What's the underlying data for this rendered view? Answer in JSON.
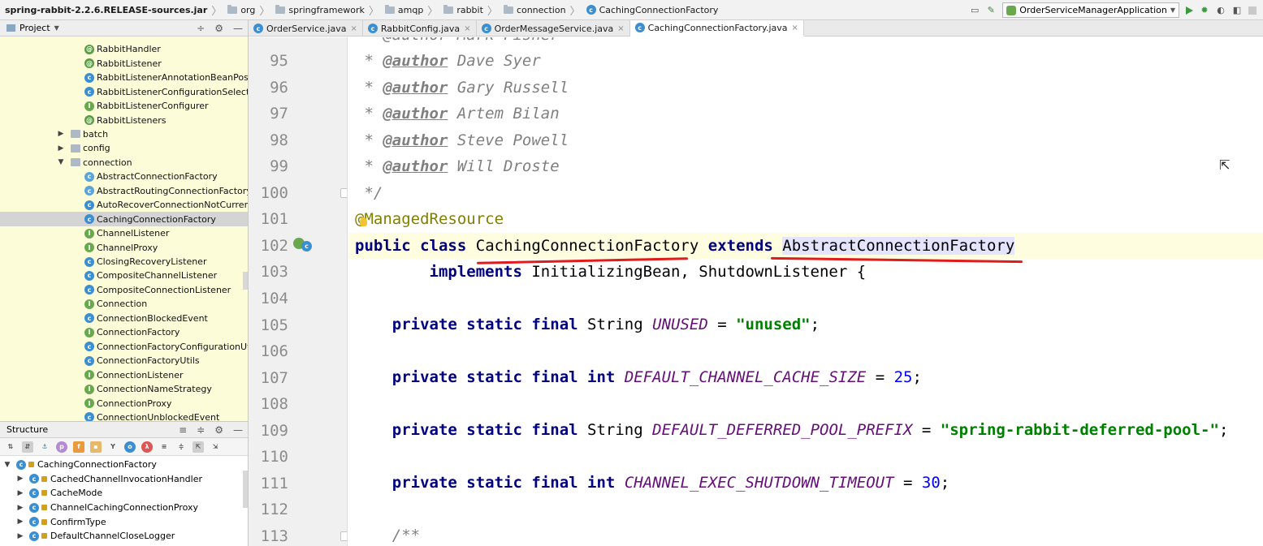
{
  "breadcrumbs": [
    {
      "label": "spring-rabbit-2.2.6.RELEASE-sources.jar",
      "icon": "jar"
    },
    {
      "label": "org",
      "icon": "folder-icon"
    },
    {
      "label": "springframework",
      "icon": "folder-icon"
    },
    {
      "label": "amqp",
      "icon": "folder-icon"
    },
    {
      "label": "rabbit",
      "icon": "folder-icon"
    },
    {
      "label": "connection",
      "icon": "folder-icon"
    },
    {
      "label": "CachingConnectionFactory",
      "icon": "class-icon"
    }
  ],
  "run_config": "OrderServiceManagerApplication",
  "project_panel": {
    "title": "Project",
    "items": [
      {
        "label": "RabbitHandler",
        "icon": "annotation",
        "depth": 3
      },
      {
        "label": "RabbitListener",
        "icon": "annotation",
        "depth": 3
      },
      {
        "label": "RabbitListenerAnnotationBeanPostProcessor",
        "icon": "class",
        "depth": 3
      },
      {
        "label": "RabbitListenerConfigurationSelector",
        "icon": "class",
        "depth": 3
      },
      {
        "label": "RabbitListenerConfigurer",
        "icon": "interface",
        "depth": 3
      },
      {
        "label": "RabbitListeners",
        "icon": "annotation",
        "depth": 3
      },
      {
        "label": "batch",
        "icon": "package",
        "depth": 2,
        "arrow": "right"
      },
      {
        "label": "config",
        "icon": "package",
        "depth": 2,
        "arrow": "right"
      },
      {
        "label": "connection",
        "icon": "package",
        "depth": 2,
        "arrow": "down"
      },
      {
        "label": "AbstractConnectionFactory",
        "icon": "abstract",
        "depth": 3
      },
      {
        "label": "AbstractRoutingConnectionFactory",
        "icon": "abstract",
        "depth": 3
      },
      {
        "label": "AutoRecoverConnectionNotCurrentlyOpenException",
        "icon": "class",
        "depth": 3
      },
      {
        "label": "CachingConnectionFactory",
        "icon": "class",
        "depth": 3,
        "selected": true
      },
      {
        "label": "ChannelListener",
        "icon": "interface",
        "depth": 3
      },
      {
        "label": "ChannelProxy",
        "icon": "interface",
        "depth": 3
      },
      {
        "label": "ClosingRecoveryListener",
        "icon": "class",
        "depth": 3
      },
      {
        "label": "CompositeChannelListener",
        "icon": "class",
        "depth": 3
      },
      {
        "label": "CompositeConnectionListener",
        "icon": "class",
        "depth": 3
      },
      {
        "label": "Connection",
        "icon": "interface",
        "depth": 3
      },
      {
        "label": "ConnectionBlockedEvent",
        "icon": "class",
        "depth": 3
      },
      {
        "label": "ConnectionFactory",
        "icon": "interface",
        "depth": 3
      },
      {
        "label": "ConnectionFactoryConfigurationUtils",
        "icon": "class",
        "depth": 3
      },
      {
        "label": "ConnectionFactoryUtils",
        "icon": "class",
        "depth": 3
      },
      {
        "label": "ConnectionListener",
        "icon": "interface",
        "depth": 3
      },
      {
        "label": "ConnectionNameStrategy",
        "icon": "interface",
        "depth": 3
      },
      {
        "label": "ConnectionProxy",
        "icon": "interface",
        "depth": 3
      },
      {
        "label": "ConnectionUnblockedEvent",
        "icon": "class",
        "depth": 3
      }
    ]
  },
  "structure_panel": {
    "title": "Structure",
    "items": [
      {
        "label": "CachingConnectionFactory",
        "arrow": "down",
        "depth": 0
      },
      {
        "label": "CachedChannelInvocationHandler",
        "arrow": "right",
        "depth": 1
      },
      {
        "label": "CacheMode",
        "arrow": "right",
        "depth": 1
      },
      {
        "label": "ChannelCachingConnectionProxy",
        "arrow": "right",
        "depth": 1
      },
      {
        "label": "ConfirmType",
        "arrow": "right",
        "depth": 1
      },
      {
        "label": "DefaultChannelCloseLogger",
        "arrow": "right",
        "depth": 1
      }
    ]
  },
  "editor_tabs": [
    {
      "label": "OrderService.java",
      "active": false
    },
    {
      "label": "RabbitConfig.java",
      "active": false
    },
    {
      "label": "OrderMessageService.java",
      "active": false
    },
    {
      "label": "CachingConnectionFactory.java",
      "active": true
    }
  ],
  "code": {
    "line_numbers": [
      "95",
      "96",
      "97",
      "98",
      "99",
      "100",
      "101",
      "102",
      "103",
      "104",
      "105",
      "106",
      "107",
      "108",
      "109",
      "110",
      "111",
      "112",
      "113"
    ],
    "partial_top": " * @author Mark Fisher",
    "authors": [
      "Dave Syer",
      "Gary Russell",
      "Artem Bilan",
      "Steve Powell",
      "Will Droste"
    ],
    "doc_tag": "@author",
    "doc_star": " * ",
    "doc_end": " */",
    "annotation": "@ManagedResource",
    "kw_public": "public",
    "kw_class": "class",
    "kw_extends": "extends",
    "kw_implements": "implements",
    "kw_private": "private",
    "kw_static": "static",
    "kw_final": "final",
    "kw_int": "int",
    "class_name": "CachingConnectionFactory",
    "super_class": "AbstractConnectionFactory",
    "interfaces": "InitializingBean, ShutdownListener {",
    "type_string": "String",
    "f1_name": "UNUSED",
    "f1_value": "\"unused\"",
    "f2_name": "DEFAULT_CHANNEL_CACHE_SIZE",
    "f2_value": "25",
    "f3_name": "DEFAULT_DEFERRED_POOL_PREFIX",
    "f3_value": "\"spring-rabbit-deferred-pool-\"",
    "f4_name": "CHANNEL_EXEC_SHUTDOWN_TIMEOUT",
    "f4_value": "30",
    "doc_open": "/**",
    "eq": " = ",
    "semi": ";"
  },
  "colors": {
    "keyword": "#000080",
    "string": "#008000",
    "number": "#0000ff",
    "field": "#660e7a",
    "annotation": "#808000",
    "comment": "#808080",
    "underline": "#e01b1b",
    "project_bg": "#fcfcd9"
  }
}
